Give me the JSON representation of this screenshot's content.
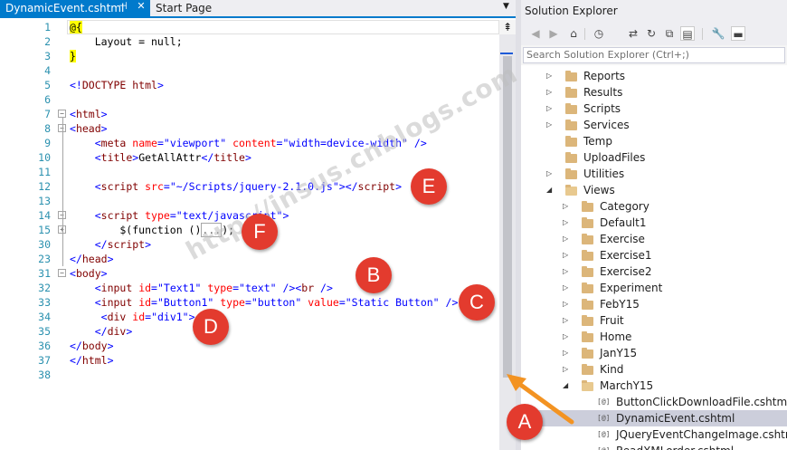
{
  "editor": {
    "tabs": [
      {
        "label": "DynamicEvent.cshtml",
        "pin_glyph": "⊣",
        "close_glyph": "✕"
      },
      {
        "label": "Start Page"
      }
    ],
    "dropdown_glyph": "▼",
    "scroll_up_glyph": "⇞",
    "lines": [
      {
        "n": "1",
        "fold": "",
        "segs": [
          [
            "t-razor",
            "@{"
          ]
        ]
      },
      {
        "n": "2",
        "fold": "",
        "segs": [
          [
            "t-plain",
            "    Layout = null;"
          ]
        ]
      },
      {
        "n": "3",
        "fold": "",
        "segs": [
          [
            "t-razor",
            "}"
          ]
        ]
      },
      {
        "n": "4",
        "fold": "",
        "segs": []
      },
      {
        "n": "5",
        "fold": "",
        "segs": [
          [
            "t-lt",
            "<!"
          ],
          [
            "t-tag",
            "DOCTYPE html"
          ],
          [
            "t-lt",
            ">"
          ]
        ]
      },
      {
        "n": "6",
        "fold": "",
        "segs": []
      },
      {
        "n": "7",
        "fold": "−",
        "segs": [
          [
            "t-lt",
            "<"
          ],
          [
            "t-tag",
            "html"
          ],
          [
            "t-lt",
            ">"
          ]
        ]
      },
      {
        "n": "8",
        "fold": "−",
        "segs": [
          [
            "t-lt",
            "<"
          ],
          [
            "t-tag",
            "head"
          ],
          [
            "t-lt",
            ">"
          ]
        ]
      },
      {
        "n": "9",
        "fold": "",
        "segs": [
          [
            "t-plain",
            "    "
          ],
          [
            "t-lt",
            "<"
          ],
          [
            "t-tag",
            "meta "
          ],
          [
            "t-attr",
            "name"
          ],
          [
            "t-lt",
            "="
          ],
          [
            "t-val",
            "\"viewport\" "
          ],
          [
            "t-attr",
            "content"
          ],
          [
            "t-lt",
            "="
          ],
          [
            "t-val",
            "\"width=device-width\" "
          ],
          [
            "t-lt",
            "/>"
          ]
        ]
      },
      {
        "n": "10",
        "fold": "",
        "segs": [
          [
            "t-plain",
            "    "
          ],
          [
            "t-lt",
            "<"
          ],
          [
            "t-tag",
            "title"
          ],
          [
            "t-lt",
            ">"
          ],
          [
            "t-plain",
            "GetAllAttr"
          ],
          [
            "t-lt",
            "</"
          ],
          [
            "t-tag",
            "title"
          ],
          [
            "t-lt",
            ">"
          ]
        ]
      },
      {
        "n": "11",
        "fold": "",
        "segs": []
      },
      {
        "n": "12",
        "fold": "",
        "segs": [
          [
            "t-plain",
            "    "
          ],
          [
            "t-lt",
            "<"
          ],
          [
            "t-tag",
            "script "
          ],
          [
            "t-attr",
            "src"
          ],
          [
            "t-lt",
            "="
          ],
          [
            "t-val",
            "\"~/Scripts/jquery-2.1.0.js\""
          ],
          [
            "t-lt",
            "></"
          ],
          [
            "t-tag",
            "script"
          ],
          [
            "t-lt",
            ">"
          ]
        ]
      },
      {
        "n": "13",
        "fold": "",
        "segs": []
      },
      {
        "n": "14",
        "fold": "−",
        "segs": [
          [
            "t-plain",
            "    "
          ],
          [
            "t-lt",
            "<"
          ],
          [
            "t-tag",
            "script "
          ],
          [
            "t-attr",
            "type"
          ],
          [
            "t-lt",
            "="
          ],
          [
            "t-val",
            "\"text/javascript\""
          ],
          [
            "t-lt",
            ">"
          ]
        ]
      },
      {
        "n": "15",
        "fold": "+",
        "segs": [
          [
            "t-plain",
            "        $(function ()"
          ],
          [
            "t-collapsed",
            "..."
          ],
          [
            "t-plain",
            ");"
          ]
        ]
      },
      {
        "n": "30",
        "fold": "",
        "segs": [
          [
            "t-plain",
            "    "
          ],
          [
            "t-lt",
            "</"
          ],
          [
            "t-tag",
            "script"
          ],
          [
            "t-lt",
            ">"
          ]
        ]
      },
      {
        "n": "23",
        "fold": "",
        "segs": [
          [
            "t-lt",
            "</"
          ],
          [
            "t-tag",
            "head"
          ],
          [
            "t-lt",
            ">"
          ]
        ]
      },
      {
        "n": "31",
        "fold": "−",
        "segs": [
          [
            "t-lt",
            "<"
          ],
          [
            "t-tag",
            "body"
          ],
          [
            "t-lt",
            ">"
          ]
        ]
      },
      {
        "n": "32",
        "fold": "",
        "segs": [
          [
            "t-plain",
            "    "
          ],
          [
            "t-lt",
            "<"
          ],
          [
            "t-tag",
            "input "
          ],
          [
            "t-attr",
            "id"
          ],
          [
            "t-lt",
            "="
          ],
          [
            "t-val",
            "\"Text1\" "
          ],
          [
            "t-attr",
            "type"
          ],
          [
            "t-lt",
            "="
          ],
          [
            "t-val",
            "\"text\" "
          ],
          [
            "t-lt",
            "/><"
          ],
          [
            "t-tag",
            "br "
          ],
          [
            "t-lt",
            "/>"
          ]
        ]
      },
      {
        "n": "33",
        "fold": "",
        "segs": [
          [
            "t-plain",
            "    "
          ],
          [
            "t-lt",
            "<"
          ],
          [
            "t-tag",
            "input "
          ],
          [
            "t-attr",
            "id"
          ],
          [
            "t-lt",
            "="
          ],
          [
            "t-val",
            "\"Button1\" "
          ],
          [
            "t-attr",
            "type"
          ],
          [
            "t-lt",
            "="
          ],
          [
            "t-val",
            "\"button\" "
          ],
          [
            "t-attr",
            "value"
          ],
          [
            "t-lt",
            "="
          ],
          [
            "t-val",
            "\"Static Button\" "
          ],
          [
            "t-lt",
            "/>"
          ]
        ]
      },
      {
        "n": "34",
        "fold": "",
        "segs": [
          [
            "t-plain",
            "     "
          ],
          [
            "t-lt",
            "<"
          ],
          [
            "t-tag",
            "div "
          ],
          [
            "t-attr",
            "id"
          ],
          [
            "t-lt",
            "="
          ],
          [
            "t-val",
            "\"div1\""
          ],
          [
            "t-lt",
            ">"
          ]
        ]
      },
      {
        "n": "35",
        "fold": "",
        "segs": [
          [
            "t-plain",
            "    "
          ],
          [
            "t-lt",
            "</"
          ],
          [
            "t-tag",
            "div"
          ],
          [
            "t-lt",
            ">"
          ]
        ]
      },
      {
        "n": "36",
        "fold": "",
        "segs": [
          [
            "t-lt",
            "</"
          ],
          [
            "t-tag",
            "body"
          ],
          [
            "t-lt",
            ">"
          ]
        ]
      },
      {
        "n": "37",
        "fold": "",
        "segs": [
          [
            "t-lt",
            "</"
          ],
          [
            "t-tag",
            "html"
          ],
          [
            "t-lt",
            ">"
          ]
        ]
      },
      {
        "n": "38",
        "fold": "",
        "segs": []
      }
    ]
  },
  "solution_explorer": {
    "title": "Solution Explorer",
    "toolbar_icons": [
      {
        "name": "back-icon",
        "glyph": "◀",
        "dim": true
      },
      {
        "name": "forward-icon",
        "glyph": "▶",
        "dim": true
      },
      {
        "name": "home-icon",
        "glyph": "⌂",
        "dim": false
      },
      {
        "name": "pending-changes-icon",
        "glyph": "◷",
        "dim": false
      },
      {
        "name": "sync-icon",
        "glyph": "⇄",
        "dim": false
      },
      {
        "name": "refresh-icon",
        "glyph": "↻",
        "dim": false
      },
      {
        "name": "collapse-all-icon",
        "glyph": "⧉",
        "dim": false
      },
      {
        "name": "show-all-files-icon",
        "glyph": "▤",
        "dim": false,
        "checked": true
      },
      {
        "name": "properties-icon",
        "glyph": "🔧",
        "dim": false
      },
      {
        "name": "preview-icon",
        "glyph": "▬",
        "dim": false,
        "checked": true
      }
    ],
    "search_placeholder": "Search Solution Explorer (Ctrl+;)",
    "tree": [
      {
        "label": "Reports",
        "depth": 0,
        "exp": "▷",
        "kind": "folder"
      },
      {
        "label": "Results",
        "depth": 0,
        "exp": "▷",
        "kind": "folder"
      },
      {
        "label": "Scripts",
        "depth": 0,
        "exp": "▷",
        "kind": "folder"
      },
      {
        "label": "Services",
        "depth": 0,
        "exp": "▷",
        "kind": "folder"
      },
      {
        "label": "Temp",
        "depth": 0,
        "exp": "",
        "kind": "folder"
      },
      {
        "label": "UploadFiles",
        "depth": 0,
        "exp": "",
        "kind": "folder"
      },
      {
        "label": "Utilities",
        "depth": 0,
        "exp": "▷",
        "kind": "folder"
      },
      {
        "label": "Views",
        "depth": 0,
        "exp": "◢",
        "kind": "folder-open"
      },
      {
        "label": "Category",
        "depth": 1,
        "exp": "▷",
        "kind": "folder"
      },
      {
        "label": "Default1",
        "depth": 1,
        "exp": "▷",
        "kind": "folder"
      },
      {
        "label": "Exercise",
        "depth": 1,
        "exp": "▷",
        "kind": "folder"
      },
      {
        "label": "Exercise1",
        "depth": 1,
        "exp": "▷",
        "kind": "folder"
      },
      {
        "label": "Exercise2",
        "depth": 1,
        "exp": "▷",
        "kind": "folder"
      },
      {
        "label": "Experiment",
        "depth": 1,
        "exp": "▷",
        "kind": "folder"
      },
      {
        "label": "FebY15",
        "depth": 1,
        "exp": "▷",
        "kind": "folder"
      },
      {
        "label": "Fruit",
        "depth": 1,
        "exp": "▷",
        "kind": "folder"
      },
      {
        "label": "Home",
        "depth": 1,
        "exp": "▷",
        "kind": "folder"
      },
      {
        "label": "JanY15",
        "depth": 1,
        "exp": "▷",
        "kind": "folder"
      },
      {
        "label": "Kind",
        "depth": 1,
        "exp": "▷",
        "kind": "folder"
      },
      {
        "label": "MarchY15",
        "depth": 1,
        "exp": "◢",
        "kind": "folder-open"
      },
      {
        "label": "ButtonClickDownloadFile.cshtml",
        "depth": 2,
        "exp": "",
        "kind": "file"
      },
      {
        "label": "DynamicEvent.cshtml",
        "depth": 2,
        "exp": "",
        "kind": "file",
        "selected": true
      },
      {
        "label": "JQueryEventChangeImage.cshtml",
        "depth": 2,
        "exp": "",
        "kind": "file"
      },
      {
        "label": "ReadXMLorder.cshtml",
        "depth": 2,
        "exp": "",
        "kind": "file"
      }
    ],
    "file_glyph": "[@]"
  },
  "annotations": {
    "badges": [
      "A",
      "B",
      "C",
      "D",
      "E",
      "F"
    ],
    "watermark": "http://insus.cnblogs.com",
    "badge_color": "#e33b2e",
    "arrow_color": "#f39322"
  }
}
